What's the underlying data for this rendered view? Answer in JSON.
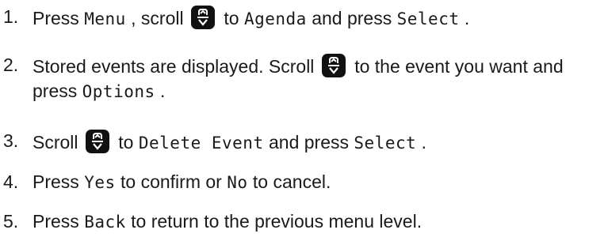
{
  "steps": [
    {
      "number": "1.",
      "parts": [
        {
          "t": "Press "
        },
        {
          "ui": "Menu"
        },
        {
          "t": ", scroll "
        },
        {
          "icon": "scroll-key-icon"
        },
        {
          "t": " to "
        },
        {
          "ui": "Agenda"
        },
        {
          "t": " and press "
        },
        {
          "ui": "Select"
        },
        {
          "t": "."
        }
      ]
    },
    {
      "number": "2.",
      "parts": [
        {
          "t": "Stored events are displayed. Scroll "
        },
        {
          "icon": "scroll-key-icon"
        },
        {
          "t": " to the event you want and press "
        },
        {
          "ui": "Options"
        },
        {
          "t": "."
        }
      ]
    },
    {
      "number": "3.",
      "parts": [
        {
          "t": "Scroll "
        },
        {
          "icon": "scroll-key-icon"
        },
        {
          "t": " to "
        },
        {
          "ui": "Delete Event"
        },
        {
          "t": " and press "
        },
        {
          "ui": "Select"
        },
        {
          "t": "."
        }
      ]
    },
    {
      "number": "4.",
      "parts": [
        {
          "t": "Press "
        },
        {
          "ui": "Yes"
        },
        {
          "t": " to confirm or "
        },
        {
          "ui": "No"
        },
        {
          "t": " to cancel."
        }
      ]
    },
    {
      "number": "5.",
      "parts": [
        {
          "t": "Press "
        },
        {
          "ui": "Back"
        },
        {
          "t": " to return to the previous menu level."
        }
      ]
    }
  ],
  "colors": {
    "text": "#1a1a1a",
    "key_bg": "#111111",
    "key_glyph": "#ffffff"
  }
}
